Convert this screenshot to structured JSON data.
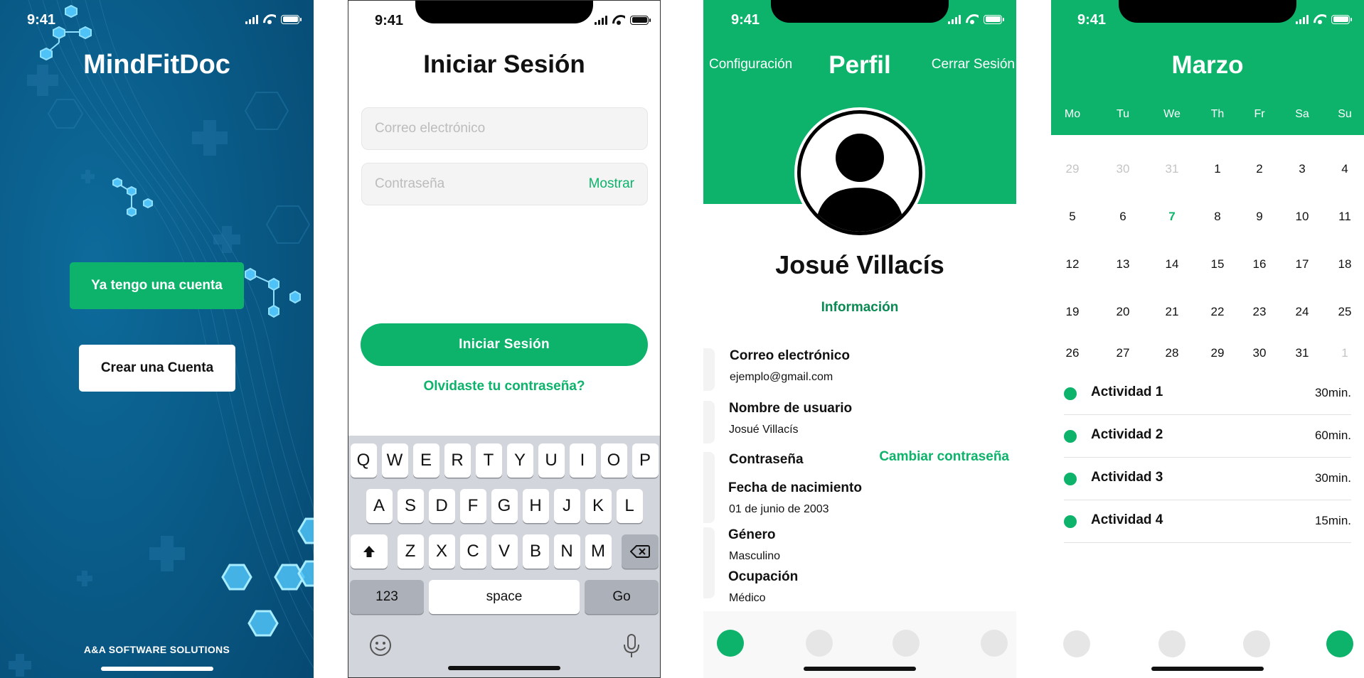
{
  "status": {
    "time": "9:41"
  },
  "welcome": {
    "title": "MindFitDoc",
    "have_account_label": "Ya tengo una cuenta",
    "create_account_label": "Crear una Cuenta",
    "company": "A&A SOFTWARE SOLUTIONS"
  },
  "login": {
    "title": "Iniciar Sesión",
    "email_placeholder": "Correo electrónico",
    "password_placeholder": "Contraseña",
    "show_label": "Mostrar",
    "submit_label": "Iniciar  Sesión",
    "forgot_label": "Olvidaste tu contraseña?",
    "keyboard": {
      "row1": [
        "Q",
        "W",
        "E",
        "R",
        "T",
        "Y",
        "U",
        "I",
        "O",
        "P"
      ],
      "row2": [
        "A",
        "S",
        "D",
        "F",
        "G",
        "H",
        "J",
        "K",
        "L"
      ],
      "row3": [
        "Z",
        "X",
        "C",
        "V",
        "B",
        "N",
        "M"
      ],
      "numbers_label": "123",
      "space_label": "space",
      "go_label": "Go"
    }
  },
  "profile": {
    "settings_label": "Configuración",
    "title": "Perfil",
    "logout_label": "Cerrar Sesión",
    "name": "Josué Villacís",
    "info_tab": "Información",
    "email_label": "Correo electrónico",
    "email_value": "ejemplo@gmail.com",
    "username_label": "Nombre de usuario",
    "username_value": "Josué Villacís",
    "password_label": "Contraseña",
    "change_password_label": "Cambiar contraseña",
    "birth_label": "Fecha de nacimiento",
    "birth_value": "01 de junio de 2003",
    "gender_label": "Género",
    "gender_value": "Masculino",
    "occupation_label": "Ocupación",
    "occupation_value": "Médico"
  },
  "calendar": {
    "month": "Marzo",
    "weekdays": [
      "Mo",
      "Tu",
      "We",
      "Th",
      "Fr",
      "Sa",
      "Su"
    ],
    "weeks": [
      [
        "29",
        "30",
        "31",
        "1",
        "2",
        "3",
        "4"
      ],
      [
        "5",
        "6",
        "7",
        "8",
        "9",
        "10",
        "11"
      ],
      [
        "12",
        "13",
        "14",
        "15",
        "16",
        "17",
        "18"
      ],
      [
        "19",
        "20",
        "21",
        "22",
        "23",
        "24",
        "25"
      ],
      [
        "26",
        "27",
        "28",
        "29",
        "30",
        "31",
        "1"
      ]
    ],
    "muted": [
      [
        0,
        0
      ],
      [
        0,
        1
      ],
      [
        0,
        2
      ],
      [
        4,
        6
      ]
    ],
    "today": [
      1,
      2
    ],
    "accent_color": "#0db36b",
    "activities": [
      {
        "name": "Actividad 1",
        "duration": "30min."
      },
      {
        "name": "Actividad 2",
        "duration": "60min."
      },
      {
        "name": "Actividad 3",
        "duration": "30min."
      },
      {
        "name": "Actividad 4",
        "duration": "15min."
      }
    ]
  },
  "colors": {
    "brand_green": "#0db36b",
    "welcome_bg": "#0b5a86"
  }
}
